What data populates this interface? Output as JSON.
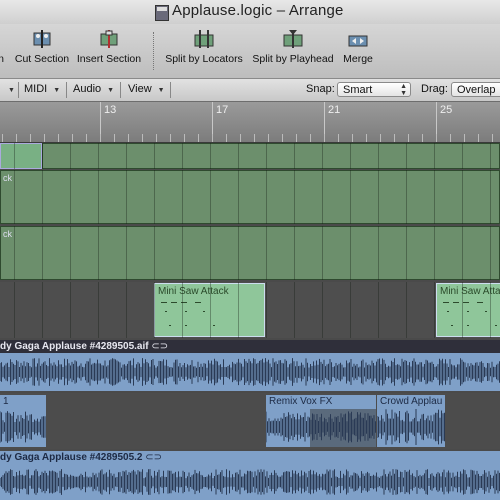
{
  "window": {
    "title": "Applause.logic – Arrange"
  },
  "toolbar": {
    "buttons": [
      {
        "label": "n",
        "icon": "cut-icon"
      },
      {
        "label": "Cut Section",
        "icon": "cut-section-icon"
      },
      {
        "label": "Insert Section",
        "icon": "insert-section-icon"
      },
      {
        "label": "Split by Locators",
        "icon": "split-locators-icon"
      },
      {
        "label": "Split by Playhead",
        "icon": "split-playhead-icon"
      },
      {
        "label": "Merge",
        "icon": "merge-icon"
      }
    ]
  },
  "subbar": {
    "menus": [
      "MIDI",
      "Audio",
      "View"
    ],
    "snap_label": "Snap:",
    "snap_value": "Smart",
    "drag_label": "Drag:",
    "drag_value": "Overlap"
  },
  "ruler": {
    "bars": [
      "13",
      "17",
      "21",
      "25"
    ]
  },
  "tracks": {
    "track1_label": "ck",
    "track2_label": "ck",
    "region_a": "Mini Saw Attack",
    "region_b": "Mini Saw Atta",
    "audio1_header": "dy Gaga Applause #4289505.aif",
    "audio2_label": "1",
    "audio2_region_b": "Remix Vox FX",
    "audio2_region_c": "Crowd Applau",
    "audio3_header": "dy Gaga Applause #4289505.2"
  },
  "colors": {
    "midi_region": "#6c8f6c",
    "midi_selected": "#8fc69a",
    "audio_region": "#7fa0c8"
  }
}
